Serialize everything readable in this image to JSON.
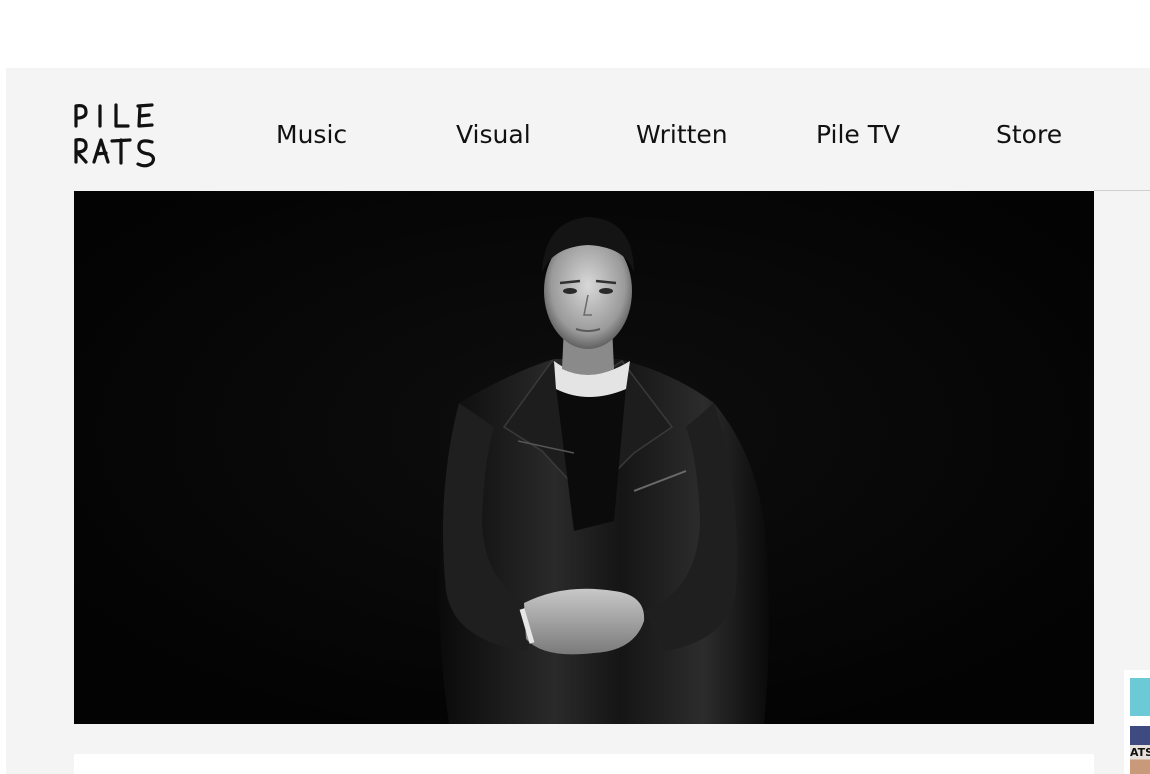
{
  "brand": {
    "logo_line1": "PILE",
    "logo_line2": "RATS"
  },
  "nav": {
    "items": [
      {
        "label": "Music"
      },
      {
        "label": "Visual"
      },
      {
        "label": "Written"
      },
      {
        "label": "Pile TV"
      },
      {
        "label": "Store"
      }
    ]
  },
  "hero": {
    "alt": "Black and white portrait of a man in a leather jacket"
  },
  "side_widget": {
    "thumb_text": "ATS"
  }
}
